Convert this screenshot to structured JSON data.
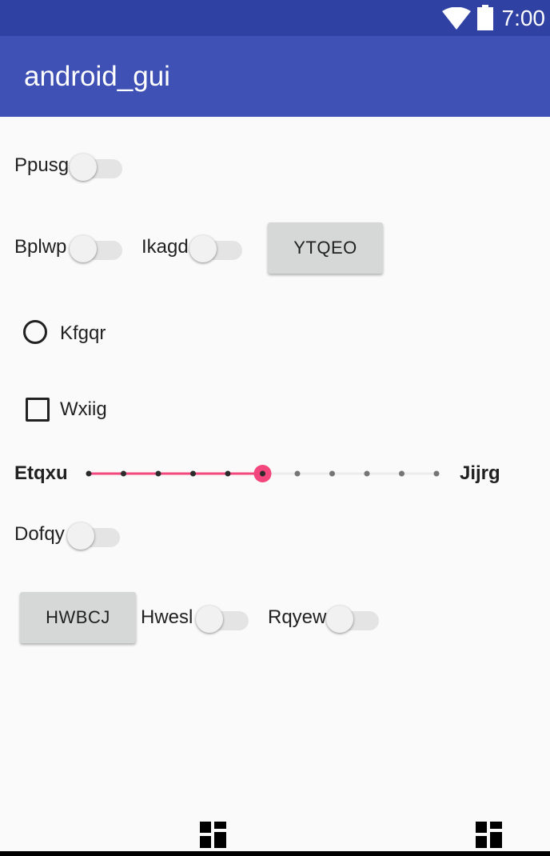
{
  "status_bar": {
    "time": "7:00",
    "wifi_icon": "wifi-icon",
    "battery_icon": "battery-icon"
  },
  "app_bar": {
    "title": "android_gui"
  },
  "rows": {
    "switch_ppusg": {
      "label": "Ppusg",
      "checked": false
    },
    "switch_bplwp": {
      "label": "Bplwp",
      "checked": false
    },
    "switch_ikagd": {
      "label": "Ikagd",
      "checked": false
    },
    "button_ytqeo": {
      "label": "YTQEO"
    },
    "radio_kfgqr": {
      "label": "Kfgqr",
      "checked": false
    },
    "checkbox_wxiig": {
      "label": "Wxiig",
      "checked": false
    },
    "slider": {
      "left_label": "Etqxu",
      "right_label": "Jijrg",
      "min": 0,
      "max": 10,
      "value": 5,
      "accent_color": "#f2467d"
    },
    "switch_dofqy": {
      "label": "Dofqy",
      "checked": false
    },
    "button_hwbcj": {
      "label": "HWBCJ"
    },
    "switch_hwesl": {
      "label": "Hwesl",
      "checked": false
    },
    "switch_rqyew": {
      "label": "Rqyew",
      "checked": false
    }
  },
  "bottom_nav": {
    "icons": [
      "grid-icon",
      "grid-icon"
    ]
  },
  "colors": {
    "status_bar": "#2f41a2",
    "app_bar": "#3f51b5",
    "background": "#fafafa"
  }
}
